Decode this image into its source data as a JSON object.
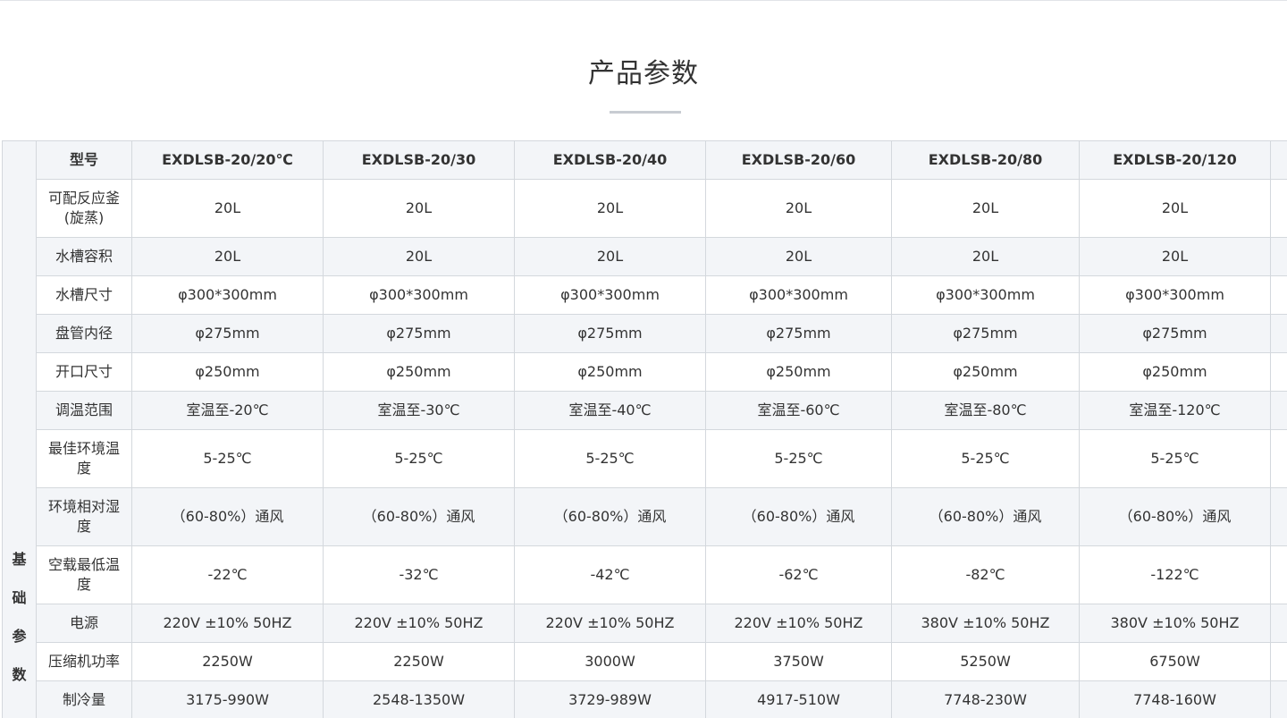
{
  "section": {
    "title": "产品参数"
  },
  "table": {
    "group_label": [
      "基",
      "础",
      "参",
      "数"
    ],
    "header": {
      "label": "型号",
      "models": [
        "EXDLSB-20/20℃",
        "EXDLSB-20/30",
        "EXDLSB-20/40",
        "EXDLSB-20/60",
        "EXDLSB-20/80",
        "EXDLSB-20/120"
      ]
    },
    "rows": [
      {
        "label": "可配反应釜(旋蒸)",
        "values": [
          "20L",
          "20L",
          "20L",
          "20L",
          "20L",
          "20L"
        ]
      },
      {
        "label": "水槽容积",
        "values": [
          "20L",
          "20L",
          "20L",
          "20L",
          "20L",
          "20L"
        ]
      },
      {
        "label": "水槽尺寸",
        "values": [
          "φ300*300mm",
          "φ300*300mm",
          "φ300*300mm",
          "φ300*300mm",
          "φ300*300mm",
          "φ300*300mm"
        ]
      },
      {
        "label": "盘管内径",
        "values": [
          "φ275mm",
          "φ275mm",
          "φ275mm",
          "φ275mm",
          "φ275mm",
          "φ275mm"
        ]
      },
      {
        "label": "开口尺寸",
        "values": [
          "φ250mm",
          "φ250mm",
          "φ250mm",
          "φ250mm",
          "φ250mm",
          "φ250mm"
        ]
      },
      {
        "label": "调温范围",
        "values": [
          "室温至-20℃",
          "室温至-30℃",
          "室温至-40℃",
          "室温至-60℃",
          "室温至-80℃",
          "室温至-120℃"
        ]
      },
      {
        "label": "最佳环境温度",
        "values": [
          "5-25℃",
          "5-25℃",
          "5-25℃",
          "5-25℃",
          "5-25℃",
          "5-25℃"
        ]
      },
      {
        "label": "环境相对湿度",
        "values": [
          "（60-80%）通风",
          "（60-80%）通风",
          "（60-80%）通风",
          "（60-80%）通风",
          "（60-80%）通风",
          "（60-80%）通风"
        ]
      },
      {
        "label": "空载最低温度",
        "values": [
          "-22℃",
          "-32℃",
          "-42℃",
          "-62℃",
          "-82℃",
          "-122℃"
        ]
      },
      {
        "label": "电源",
        "values": [
          "220V ±10%  50HZ",
          "220V ±10%  50HZ",
          "220V ±10%  50HZ",
          "220V ±10%  50HZ",
          "380V ±10%  50HZ",
          "380V ±10%  50HZ"
        ]
      },
      {
        "label": "压缩机功率",
        "values": [
          "2250W",
          "2250W",
          "3000W",
          "3750W",
          "5250W",
          "6750W"
        ]
      },
      {
        "label": "制冷量",
        "values": [
          "3175-990W",
          "2548-1350W",
          "3729-989W",
          "4917-510W",
          "7748-230W",
          "7748-160W"
        ]
      }
    ]
  }
}
